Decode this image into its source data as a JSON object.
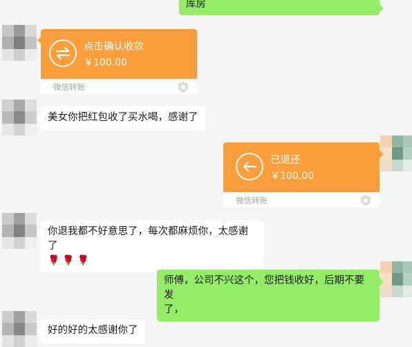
{
  "messages": {
    "m0_text": "库房",
    "m1": {
      "title": "点击确认收款",
      "amount": "￥100.00",
      "footer": "微信转账"
    },
    "m2_text": "美女你把红包收了买水喝，感谢了",
    "m3": {
      "title": "已退还",
      "amount": "￥100.00",
      "footer": "微信转账"
    },
    "m4_line1": "你退我都不好意思了，每次都麻烦你，太感谢了",
    "m4_emoji": "🌹🌹🌹",
    "m5_line1": "师傅，公司不兴这个，您把钱收好，后期不要发",
    "m5_line2": "了，",
    "m6_text": "好的好的太感谢你了"
  },
  "colors": {
    "background": "#f5f5f5",
    "self_bubble": "#95ec69",
    "other_bubble": "#ffffff",
    "transfer_orange": "#fa9d3b",
    "footer_text": "#a3a3a3"
  },
  "icons": {
    "transfer_pending": "transfer-arrows-icon",
    "transfer_returned": "return-arrow-icon",
    "security": "shield-icon"
  }
}
